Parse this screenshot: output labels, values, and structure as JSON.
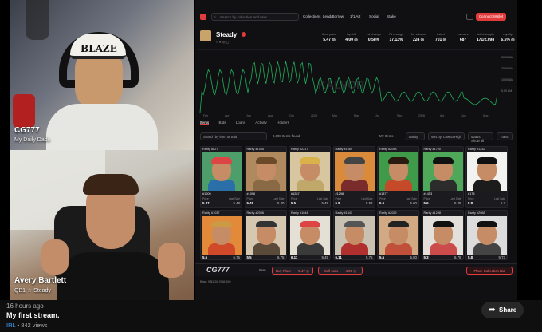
{
  "cam_top": {
    "name": "CG777",
    "subtitle": "My Daily Dads",
    "hat_text": "BLAZE"
  },
  "cam_bottom": {
    "name": "Avery Bartlett",
    "subtitle": "QB1 ☆ Steady"
  },
  "marketplace": {
    "search_placeholder": "Search by collection and user ...",
    "nav": [
      "Collections",
      "Lend/Borrow",
      "1/1 Art",
      "Social",
      "Stake"
    ],
    "connect_label": "Connect Wallet",
    "collection": {
      "name": "Steady",
      "stats": [
        {
          "label": "floor price",
          "value": "5.47 ◎"
        },
        {
          "label": "top bid",
          "value": "4.00 ◎"
        },
        {
          "label": "1d change",
          "value": "0.58%"
        },
        {
          "label": "7d change",
          "value": "17.13%"
        },
        {
          "label": "1d volume",
          "value": "224 ◎"
        },
        {
          "label": "listed",
          "value": "701 ◎"
        },
        {
          "label": "owners",
          "value": "687"
        },
        {
          "label": "listed supply",
          "value": "171/2,098"
        },
        {
          "label": "royalty",
          "value": "6.5% ◎"
        }
      ],
      "chart_y_ticks": [
        "30.00 AM",
        "20.00 AM",
        "10.00 AM",
        "5.00 AM"
      ],
      "chart_x_ticks": [
        "Feb",
        "Apr",
        "Jun",
        "Aug",
        "Oct",
        "2025",
        "Mar",
        "May",
        "Jul",
        "Sep",
        "2026",
        "Apr",
        "Jun",
        "Aug"
      ],
      "watermark": "KALVOR"
    },
    "tabs": [
      "Items",
      "Bids",
      "Loans",
      "Activity",
      "Holders"
    ],
    "filter": {
      "search": "Search by item or trait",
      "toggle": "2,098 Items found",
      "my_items": "My Items",
      "rarity": "Rarity",
      "sort": "sort by: Low to High",
      "status": "status: Show all",
      "traits": "Traits"
    },
    "cards_row1": [
      {
        "rarity": "Rarity #827",
        "id": "#1000",
        "price": "5.47",
        "last": "5.48"
      },
      {
        "rarity": "Rarity #1065",
        "id": "#1096",
        "price": "5.48",
        "last": "5.40"
      },
      {
        "rarity": "Rarity #2217",
        "id": "#1287",
        "price": "5.5",
        "last": "5.49"
      },
      {
        "rarity": "Rarity #1069",
        "id": "#1298",
        "price": "5.8",
        "last": "5.52"
      },
      {
        "rarity": "Rarity #2098",
        "id": "#1377",
        "price": "5.6",
        "last": "5.60"
      },
      {
        "rarity": "Rarity #1700",
        "id": "#1453",
        "price": "5.6",
        "last": "5.45"
      },
      {
        "rarity": "Rarity #1232",
        "id": "#178",
        "price": "5.8",
        "last": "5.7"
      }
    ],
    "cards_row2": [
      {
        "rarity": "Rarity #1037",
        "id": "",
        "price": "5.5",
        "last": "6.75"
      },
      {
        "rarity": "Rarity #2096",
        "id": "",
        "price": "5.5",
        "last": "6.75"
      },
      {
        "rarity": "Rarity #1644",
        "id": "",
        "price": "6.11",
        "last": "5.45"
      },
      {
        "rarity": "Rarity #1841",
        "id": "",
        "price": "6.11",
        "last": "5.75"
      },
      {
        "rarity": "Rarity #2029",
        "id": "",
        "price": "5.5",
        "last": "5.50"
      },
      {
        "rarity": "Rarity #1298",
        "id": "",
        "price": "5.3",
        "last": "6.75"
      },
      {
        "rarity": "Rarity #2068",
        "id": "",
        "price": "5.8",
        "last": "5.73"
      }
    ],
    "price_label": "Price",
    "last_sale_label": "Last Sale",
    "bottom": {
      "items_label": "Item",
      "buy_floor": "Buy Floor",
      "buy_floor_price": "5.47 ◎",
      "sell_now": "Sell Now",
      "sell_now_price": "4.00 ◎",
      "place_bid": "Place Collection Bid"
    },
    "cam_watermark": "CG777",
    "status": "Base  ◎$1.26  ◎$8,800"
  },
  "video": {
    "ago": "16 hours ago",
    "title": "My first stream.",
    "channel": "IRL",
    "views": "• 842 views",
    "share": "Share"
  },
  "colors": {
    "accent": "#e23b3b",
    "chart_line": "#1fae5b",
    "link": "#3ea6ff"
  }
}
